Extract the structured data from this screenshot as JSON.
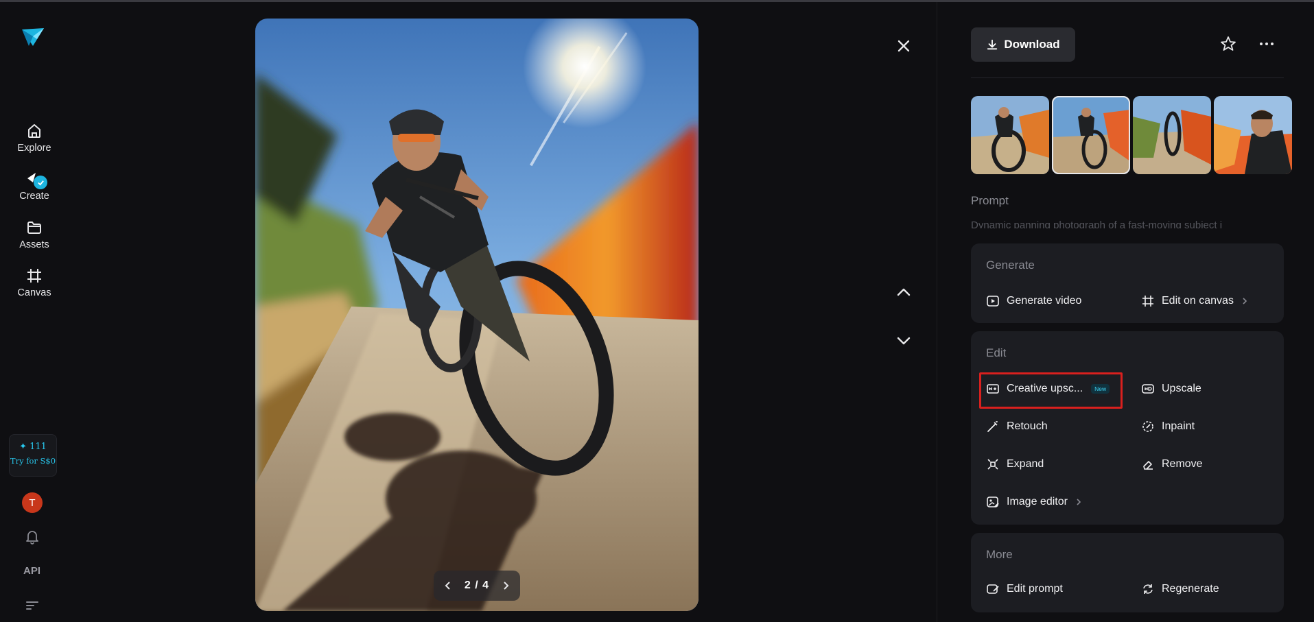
{
  "nav": {
    "items": [
      {
        "label": "Explore",
        "icon": "home-icon"
      },
      {
        "label": "Create",
        "icon": "create-icon"
      },
      {
        "label": "Assets",
        "icon": "folder-icon"
      },
      {
        "label": "Canvas",
        "icon": "canvas-icon"
      }
    ],
    "promo_points": "✦ 111",
    "promo_text": "Try for S$0",
    "avatar_initial": "T",
    "api_label": "API"
  },
  "viewer": {
    "page_indicator": "2 / 4"
  },
  "panel": {
    "download_label": "Download",
    "prompt_label": "Prompt",
    "prompt_text": "Dynamic panning photograph of a fast-moving subject i",
    "generate": {
      "title": "Generate",
      "actions": [
        "Generate video",
        "Edit on canvas"
      ]
    },
    "edit": {
      "title": "Edit",
      "actions": [
        "Creative upsc...",
        "Upscale",
        "Retouch",
        "Inpaint",
        "Expand",
        "Remove",
        "Image editor"
      ],
      "new_badge": "New"
    },
    "more": {
      "title": "More",
      "actions": [
        "Edit prompt",
        "Regenerate"
      ]
    }
  },
  "colors": {
    "accent": "#1db5e0",
    "highlight_box": "#d9201e",
    "panel_card": "#1c1d22"
  }
}
